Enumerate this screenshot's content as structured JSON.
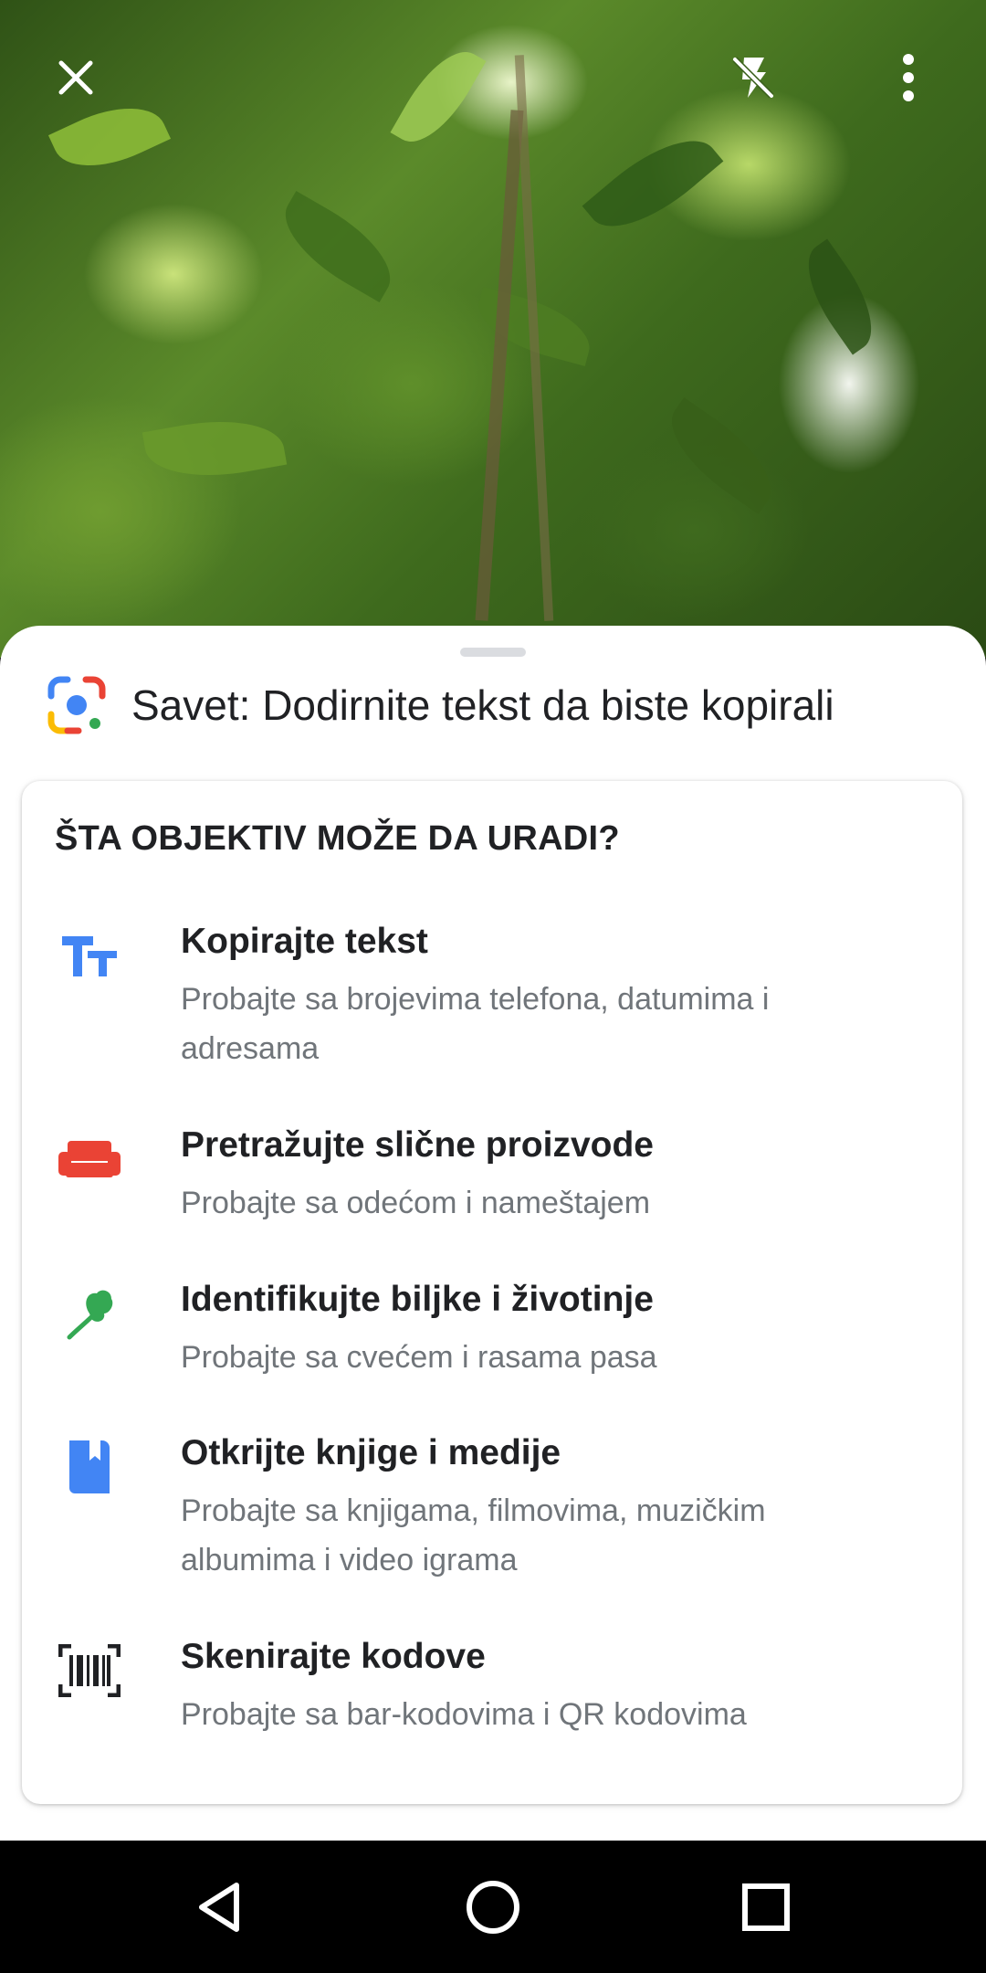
{
  "camera": {
    "close_icon": "close-icon",
    "flash_icon": "flash-off-icon",
    "menu_icon": "more-vert-icon"
  },
  "sheet": {
    "tip_icon": "google-lens-icon",
    "tip_text": "Savet: Dodirnite tekst da biste kopirali"
  },
  "card": {
    "title": "ŠTA OBJEKTIV MOŽE DA URADI?",
    "items": [
      {
        "icon": "text-format-icon",
        "color": "#4285f4",
        "title": "Kopirajte tekst",
        "desc": "Probajte sa brojevima telefona, datumima i adresama"
      },
      {
        "icon": "sofa-icon",
        "color": "#ea4335",
        "title": "Pretražujte slične proizvode",
        "desc": "Probajte sa odećom i nameštajem"
      },
      {
        "icon": "leaf-icon",
        "color": "#34a853",
        "title": "Identifikujte biljke i životinje",
        "desc": "Probajte sa cvećem i rasama pasa"
      },
      {
        "icon": "book-icon",
        "color": "#4285f4",
        "title": "Otkrijte knjige i medije",
        "desc": "Probajte sa knjigama, filmovima, muzičkim albumima i video igrama"
      },
      {
        "icon": "barcode-icon",
        "color": "#202124",
        "title": "Skenirajte kodove",
        "desc": "Probajte sa bar-kodovima i QR kodovima"
      }
    ]
  },
  "navbar": {
    "back_icon": "back-triangle-icon",
    "home_icon": "home-circle-icon",
    "recents_icon": "recents-square-icon"
  }
}
